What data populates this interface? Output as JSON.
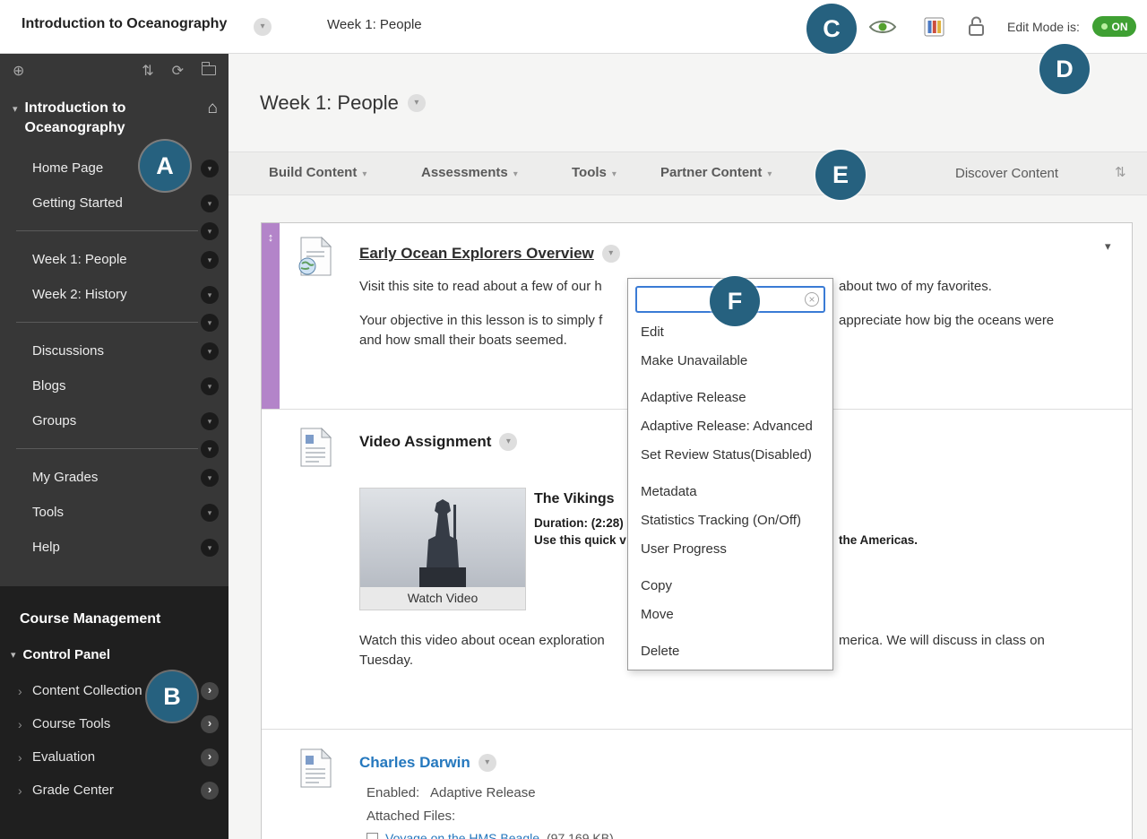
{
  "colors": {
    "badge_blue": "#26617f",
    "link_blue": "#2578be",
    "menu_focus_blue": "#3a7bd5",
    "edit_on_green": "#3fa033",
    "drag_purple": "#b384c9",
    "sidebar_dark": "#373737",
    "sidebar_darker": "#1f1f1f"
  },
  "annotations": {
    "a": "A",
    "b": "B",
    "c": "C",
    "d": "D",
    "e": "E",
    "f": "F"
  },
  "topbar": {
    "course_title": "Introduction to Oceanography",
    "breadcrumb": "Week 1: People",
    "edit_mode_label": "Edit Mode is:",
    "edit_mode_value": "ON"
  },
  "sidebar": {
    "course_title": "Introduction to Oceanography",
    "items": [
      "Home Page",
      "Getting Started",
      "Week 1: People",
      "Week 2: History",
      "Discussions",
      "Blogs",
      "Groups",
      "My Grades",
      "Tools",
      "Help"
    ],
    "management": {
      "heading": "Course Management",
      "control_panel": "Control Panel",
      "items": [
        "Content Collection",
        "Course Tools",
        "Evaluation",
        "Grade Center"
      ]
    }
  },
  "main": {
    "page_title": "Week 1: People",
    "action_bar": {
      "items": [
        "Build Content",
        "Assessments",
        "Tools",
        "Partner Content"
      ],
      "discover": "Discover Content"
    },
    "item1": {
      "title": "Early Ocean Explorers Overview",
      "para1_left": "Visit this site to read about a few of our h",
      "para1_right": "about two of my favorites.",
      "para2_left": "Your objective in this lesson is to simply f",
      "para2_right": "appreciate how big the oceans were",
      "para2_line2": "and how small their boats seemed."
    },
    "menu": {
      "items": [
        "Edit",
        "Make Unavailable",
        "Adaptive Release",
        "Adaptive Release: Advanced",
        "Set Review Status(Disabled)",
        "Metadata",
        "Statistics Tracking (On/Off)",
        "User Progress",
        "Copy",
        "Move",
        "Delete"
      ]
    },
    "item2": {
      "title": "Video Assignment",
      "video_title": "The Vikings",
      "video_duration": "Duration: (2:28)",
      "video_blurb_left": "Use this quick v",
      "video_blurb_right": "the Americas.",
      "watch_video": "Watch Video",
      "para_left": "Watch this video about ocean exploration",
      "para_right": "merica. We will discuss in class on",
      "para_line2": "Tuesday."
    },
    "item3": {
      "title": "Charles Darwin",
      "enabled_label": "Enabled:",
      "enabled_value": "Adaptive Release",
      "attached_label": "Attached Files:",
      "file_name": "Voyage on the HMS Beagle",
      "file_size": "(97.169 KB)"
    }
  }
}
